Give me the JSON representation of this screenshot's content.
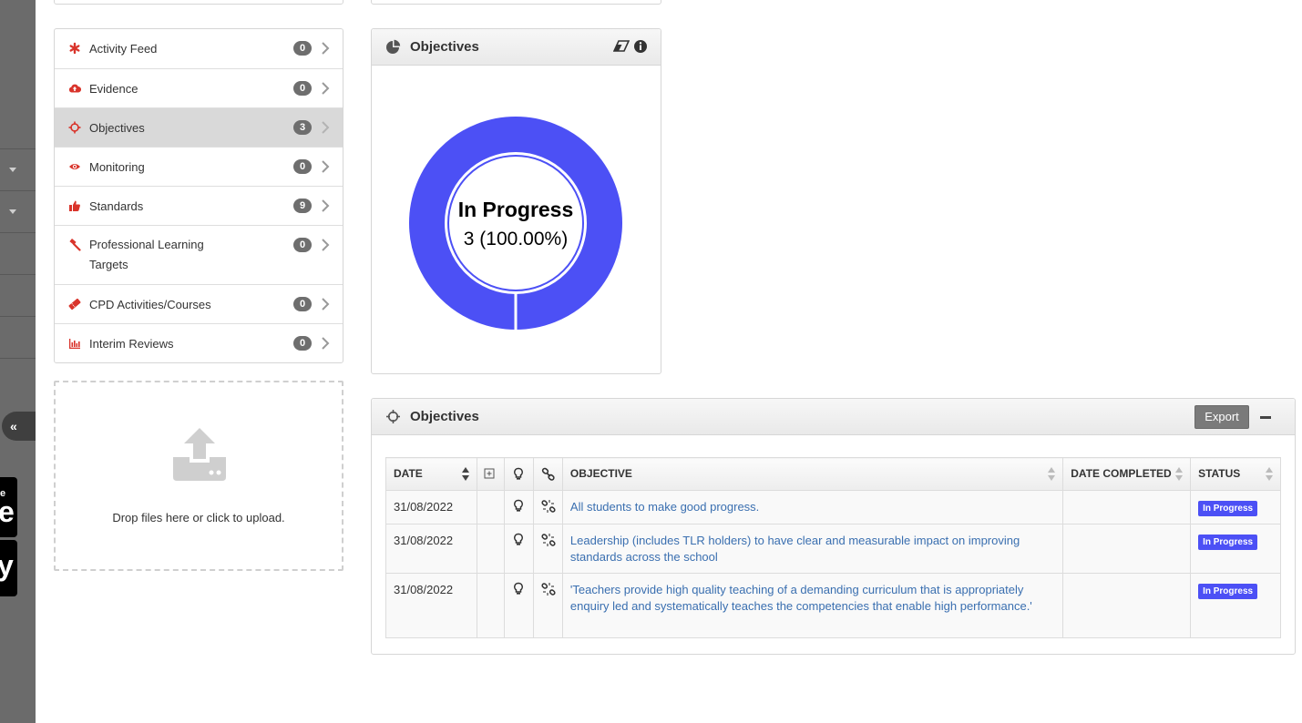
{
  "rail": {
    "collapse_glyph": "«",
    "badge_a_small": "e",
    "badge_a_large": "e",
    "badge_b_large": "y"
  },
  "menu": {
    "items": [
      {
        "label": "Activity Feed",
        "count": "0",
        "icon": "asterisk-icon"
      },
      {
        "label": "Evidence",
        "count": "0",
        "icon": "cloud-upload-icon"
      },
      {
        "label": "Objectives",
        "count": "3",
        "icon": "crosshairs-icon",
        "active": true
      },
      {
        "label": "Monitoring",
        "count": "0",
        "icon": "eye-icon"
      },
      {
        "label": "Standards",
        "count": "9",
        "icon": "thumbs-up-icon"
      },
      {
        "label": "Professional Learning Targets",
        "count": "0",
        "icon": "gavel-icon"
      },
      {
        "label": "CPD Activities/Courses",
        "count": "0",
        "icon": "ticket-icon"
      },
      {
        "label": "Interim Reviews",
        "count": "0",
        "icon": "bar-chart-icon"
      }
    ]
  },
  "dropzone": {
    "text": "Drop files here or click to upload."
  },
  "chart_panel": {
    "title": "Objectives"
  },
  "chart_data": {
    "type": "pie",
    "categories": [
      "In Progress"
    ],
    "values": [
      3
    ],
    "center_label": "In Progress",
    "center_value": "3 (100.00%)",
    "colors": [
      "#4c50f5"
    ]
  },
  "table_panel": {
    "title": "Objectives",
    "export_label": "Export",
    "columns": [
      "DATE",
      "",
      "",
      "",
      "OBJECTIVE",
      "DATE COMPLETED",
      "STATUS"
    ],
    "rows": [
      {
        "date": "31/08/2022",
        "objective": "All students to make good progress.",
        "date_completed": "",
        "status": "In Progress"
      },
      {
        "date": "31/08/2022",
        "objective": "Leadership (includes TLR holders) to have clear and measurable impact on improving standards across the school",
        "date_completed": "",
        "status": "In Progress"
      },
      {
        "date": "31/08/2022",
        "objective": "'Teachers provide high quality teaching of a demanding curriculum that is appropriately enquiry led and systematically teaches the competencies that enable high performance.'",
        "date_completed": "",
        "status": "In Progress"
      }
    ]
  },
  "colors": {
    "accent_red": "#d9342b",
    "status_blue": "#4c50f5",
    "link_blue": "#3a6fb0"
  }
}
